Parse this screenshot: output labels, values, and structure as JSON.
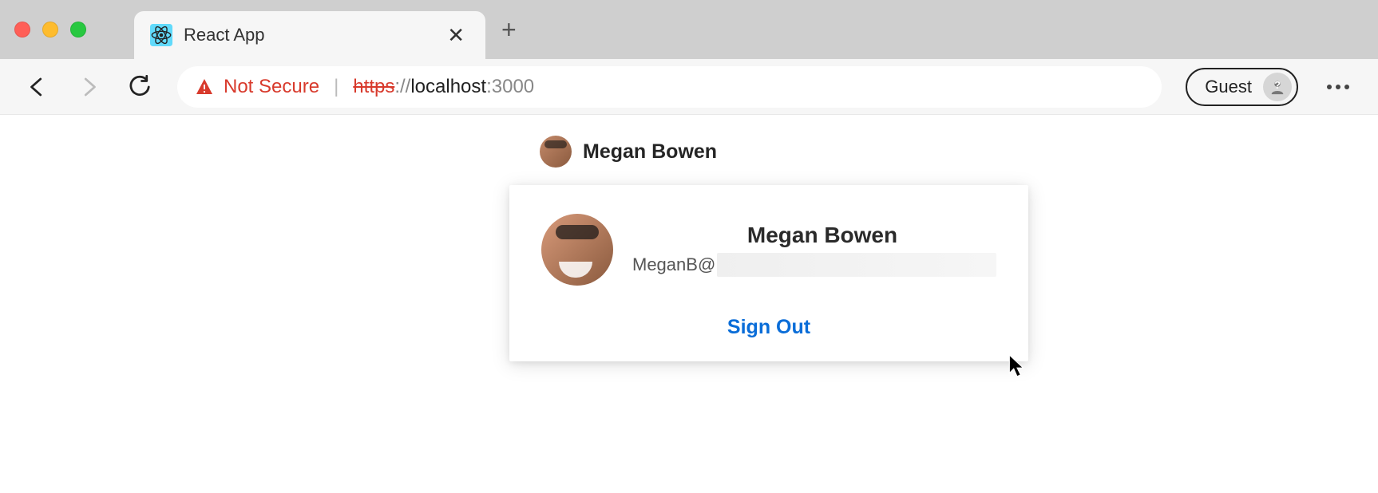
{
  "browser": {
    "tab_title": "React App",
    "security_label": "Not Secure",
    "url_scheme": "https",
    "url_scheme_sep": "://",
    "url_host": "localhost",
    "url_port": ":3000",
    "profile_label": "Guest"
  },
  "content": {
    "header_name": "Megan Bowen",
    "card_name": "Megan Bowen",
    "email_prefix": "MeganB@",
    "signout_label": "Sign Out"
  }
}
